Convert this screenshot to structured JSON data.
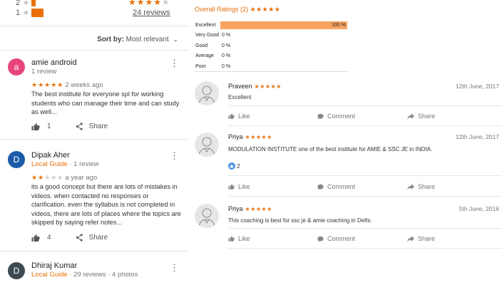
{
  "left": {
    "histogram": [
      {
        "n": "2",
        "fill": 0.05
      },
      {
        "n": "1",
        "fill": 0.15
      }
    ],
    "top_rating_stars": 4,
    "total_reviews": "24 reviews",
    "sort": {
      "label": "Sort by:",
      "value": "Most relevant"
    },
    "reviews": [
      {
        "initial": "a",
        "avatar_color": "#e8457b",
        "name": "amie android",
        "sub": "1 review",
        "local_guide": "",
        "stars": 5,
        "time": "2 weeks ago",
        "text": "The best institute for everyone spl for working students who can manage their time and can study as well...",
        "likes": "1",
        "share": "Share"
      },
      {
        "initial": "D",
        "avatar_color": "#1b5aa8",
        "name": "Dipak Aher",
        "sub": "· 1 review",
        "local_guide": "Local Guide",
        "stars": 2,
        "time": "a year ago",
        "text": "its a good concept but there are lots of mistakes in videos. when contacted no responses or clarification.  even the syllabus is not completed in videos, there are lots of places where the topics are skipped by saying refer notes...",
        "likes": "4",
        "share": "Share"
      },
      {
        "initial": "D",
        "avatar_color": "#3e4a52",
        "name": "Dhiraj Kumar",
        "sub": "· 29 reviews · 4 photos",
        "local_guide": "Local Guide"
      }
    ]
  },
  "right": {
    "overall_title": "Overall Ratings (2)",
    "overall_stars": "★★★★★",
    "ratings": [
      {
        "label": "Excellent",
        "pct": "100 %",
        "fill": 1.0
      },
      {
        "label": "Very Good",
        "pct": "0 %",
        "fill": 0
      },
      {
        "label": "Good",
        "pct": "0 %",
        "fill": 0
      },
      {
        "label": "Average",
        "pct": "0 %",
        "fill": 0
      },
      {
        "label": "Poor",
        "pct": "0 %",
        "fill": 0
      }
    ],
    "actions": {
      "like": "Like",
      "comment": "Comment",
      "share": "Share"
    },
    "comments": [
      {
        "name": "Praveen",
        "stars": "★★★★★",
        "date": "12th June, 2017",
        "text": "Excellent",
        "likes": ""
      },
      {
        "name": "Priya",
        "stars": "★★★★★",
        "date": "12th June, 2017",
        "text": "MODULATION INSTITUTE one of the best institute for AMIE & SSC JE in INDIA.",
        "likes": "2"
      },
      {
        "name": "Priya",
        "stars": "★★★★★",
        "date": "5th June, 2016",
        "text": "This coaching is best for ssc je & amie coaching in Delhi.",
        "likes": ""
      }
    ]
  },
  "colors": {
    "accent": "#e8710a",
    "bar": "#f7a461",
    "like_blue": "#4a90e2"
  },
  "icons": [
    "more-vert-icon",
    "thumb-up-icon",
    "share-icon",
    "comment-icon",
    "user-silhouette-icon",
    "chevron-down-icon",
    "star-icon"
  ]
}
